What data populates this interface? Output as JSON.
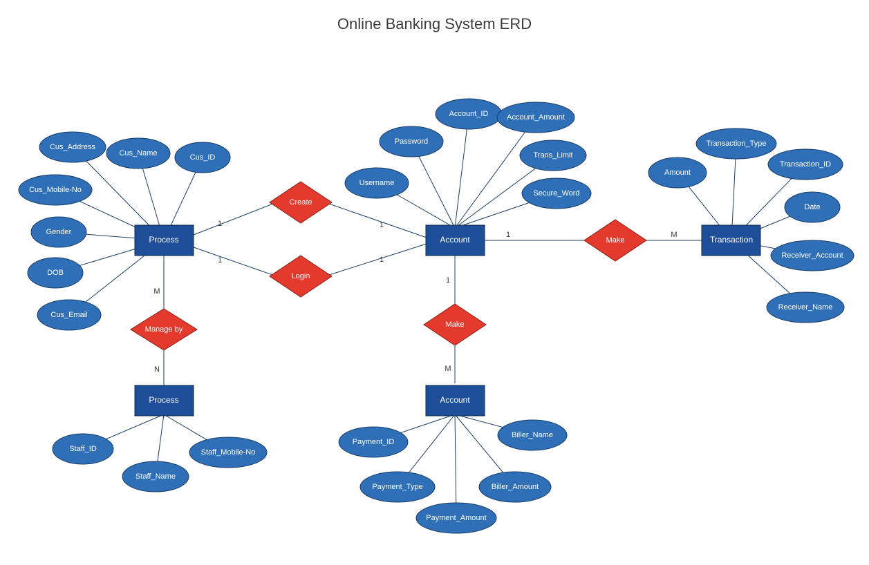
{
  "title": "Online Banking System ERD",
  "entities": {
    "process": "Process",
    "process2": "Process",
    "account": "Account",
    "account2": "Account",
    "transaction": "Transaction"
  },
  "relationships": {
    "create": "Create",
    "login": "Login",
    "manageBy": "Manage by",
    "makeAccount": "Make",
    "makeTrans": "Make"
  },
  "attributes": {
    "process": [
      "Cus_Address",
      "Cus_Name",
      "Cus_ID",
      "Cus_Mobile-No",
      "Gender",
      "DOB",
      "Cus_Email"
    ],
    "account": [
      "Username",
      "Password",
      "Account_ID",
      "Account_Amount",
      "Trans_Limit",
      "Secure_Word"
    ],
    "transaction": [
      "Amount",
      "Transaction_Type",
      "Transaction_ID",
      "Date",
      "Receiver_Account",
      "Receiver_Name"
    ],
    "process2": [
      "Staff_ID",
      "Staff_Name",
      "Staff_Mobile-No"
    ],
    "account2": [
      "Payment_ID",
      "Payment_Type",
      "Payment_Amount",
      "Biller_Amount",
      "Biller_Name"
    ]
  },
  "cardinality": {
    "processCreate": "1",
    "createAccount": "1",
    "processLogin": "1",
    "loginAccount": "1",
    "processManage": "M",
    "manageProcess2": "N",
    "accountMake1": "1",
    "make1Account2": "M",
    "accountMake2": "1",
    "make2Trans": "M"
  }
}
